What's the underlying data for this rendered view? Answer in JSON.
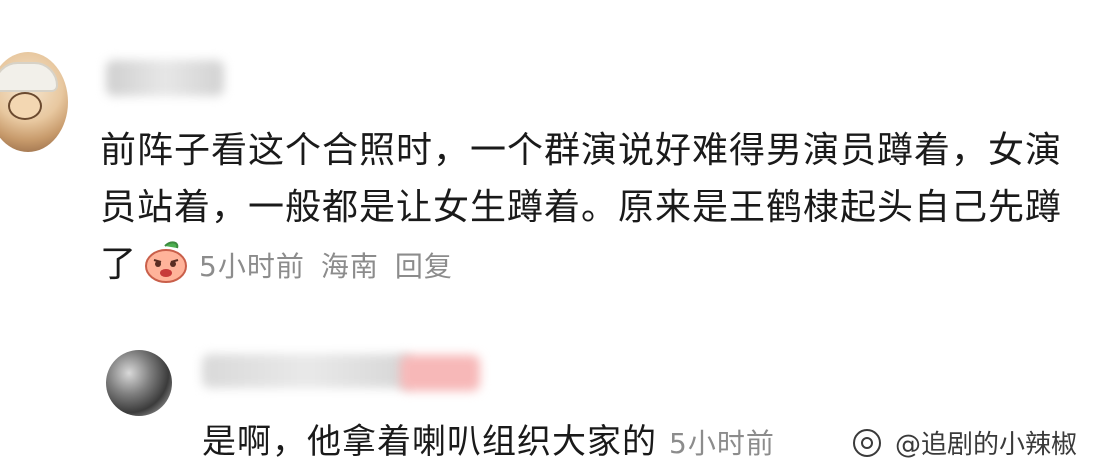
{
  "comment": {
    "text": "前阵子看这个合照时，一个群演说好难得男演员蹲着，女演员站着，一般都是让女生蹲着。原来是王鹤棣起头自己先蹲了",
    "time": "5小时前",
    "location": "海南",
    "reply_label": "回复",
    "emoji": "angry-face-emoji"
  },
  "reply": {
    "text": "是啊，他拿着喇叭组织大家的",
    "time": "5小时前"
  },
  "watermark": {
    "text": "@追剧的小辣椒"
  }
}
